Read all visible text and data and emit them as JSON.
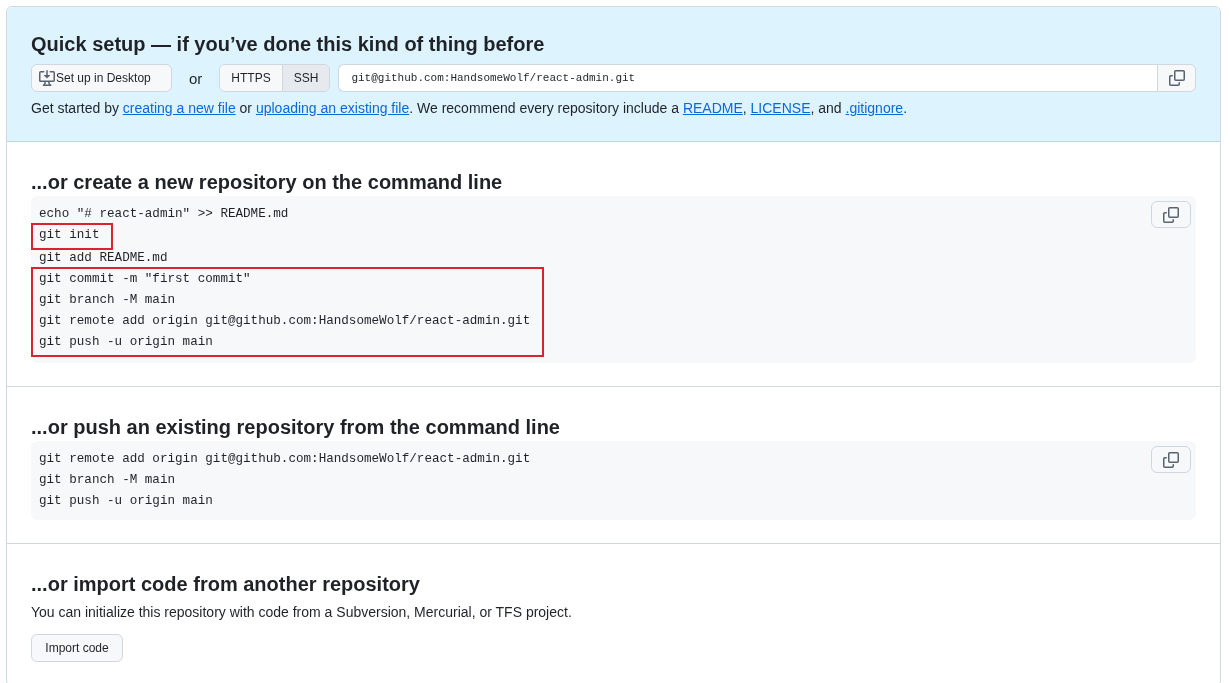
{
  "quick_setup": {
    "title": "Quick setup — if you’ve done this kind of thing before",
    "desktop_button": "Set up in Desktop",
    "or_label": "or",
    "protocol_tabs": [
      {
        "label": "HTTPS",
        "selected": false
      },
      {
        "label": "SSH",
        "selected": true
      }
    ],
    "clone_url": "git@github.com:HandsomeWolf/react-admin.git",
    "help_text": [
      {
        "kind": "text",
        "text": "Get started by "
      },
      {
        "kind": "link",
        "text": "creating a new file"
      },
      {
        "kind": "text",
        "text": " or "
      },
      {
        "kind": "link",
        "text": "uploading an existing file"
      },
      {
        "kind": "text",
        "text": ". We recommend every repository include a "
      },
      {
        "kind": "link",
        "text": "README"
      },
      {
        "kind": "text",
        "text": ", "
      },
      {
        "kind": "link",
        "text": "LICENSE"
      },
      {
        "kind": "text",
        "text": ", and "
      },
      {
        "kind": "link",
        "text": ".gitignore"
      },
      {
        "kind": "text",
        "text": "."
      }
    ]
  },
  "sections": [
    {
      "kind": "code",
      "title": "...or create a new repository on the command line",
      "code_groups": [
        {
          "highlighted": false,
          "lines": [
            "echo \"# react-admin\" >> README.md"
          ]
        },
        {
          "highlighted": true,
          "lines": [
            "git init"
          ]
        },
        {
          "highlighted": false,
          "lines": [
            "git add README.md"
          ]
        },
        {
          "highlighted": true,
          "lines": [
            "git commit -m \"first commit\"",
            "git branch -M main",
            "git remote add origin git@github.com:HandsomeWolf/react-admin.git",
            "git push -u origin main"
          ]
        }
      ]
    },
    {
      "kind": "code",
      "title": "...or push an existing repository from the command line",
      "code_groups": [
        {
          "highlighted": false,
          "lines": [
            "git remote add origin git@github.com:HandsomeWolf/react-admin.git",
            "git branch -M main",
            "git push -u origin main"
          ]
        }
      ]
    },
    {
      "kind": "import",
      "title": "...or import code from another repository",
      "description": "You can initialize this repository with code from a Subversion, Mercurial, or TFS project.",
      "button": "Import code"
    }
  ]
}
